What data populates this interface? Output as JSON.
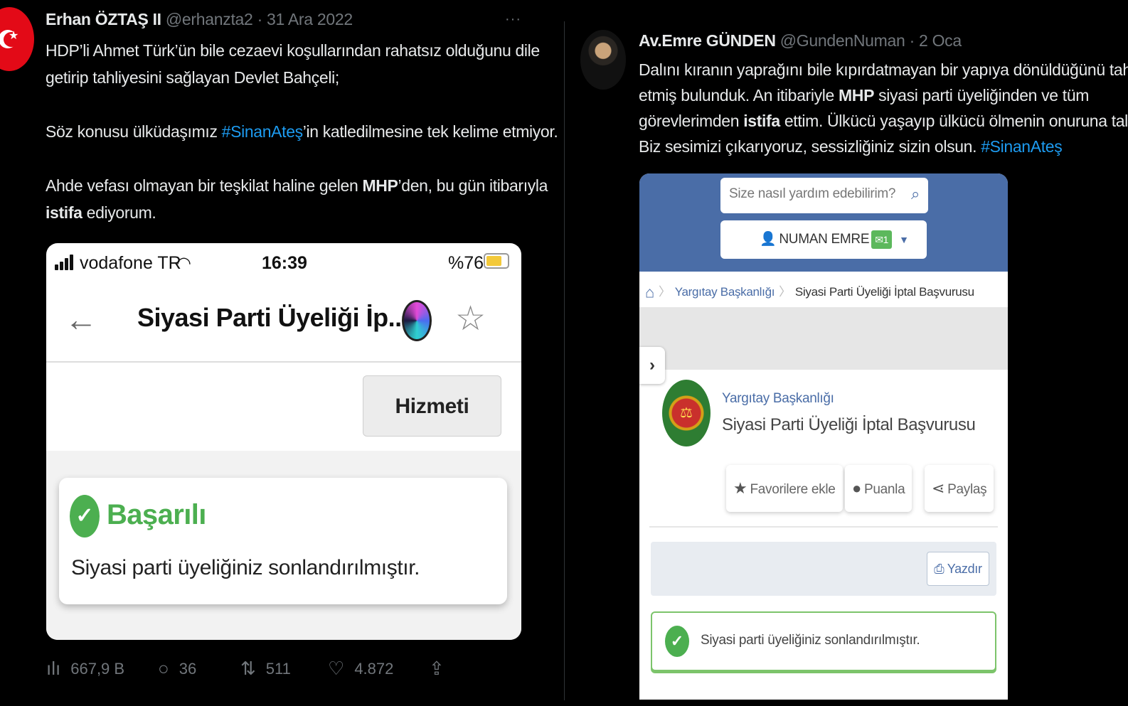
{
  "left_tweet": {
    "name": "Erhan ÖZTAŞ II",
    "handle_date": "@erhanzta2 · 31 Ara 2022",
    "more": "···",
    "p1a": "HDP’li Ahmet Türk’ün bile cezaevi koşullarından rahatsız olduğunu dile",
    "p1b": "getirip tahliyesini sağlayan Devlet Bahçeli;",
    "p2_pre": "Söz konusu ülküdaşımız ",
    "p2_tag": "#SinanAteş",
    "p2_post": "’in katledilmesine tek kelime etmiyor.",
    "p3_pre": "Ahde vefası olmayan bir teşkilat haline gelen ",
    "p3_bold": "MHP",
    "p3_post": "’den, bu gün itibarıyla",
    "p4_bold": "istifa",
    "p4_post": " ediyorum.",
    "screenshot": {
      "carrier": "vodafone TR",
      "time": "16:39",
      "battery": "%76",
      "battery_level": 0.76,
      "title": "Siyasi Parti Üyeliği İp...",
      "close_button": "Hizmeti Kapat",
      "status": "Başarılı",
      "message": "Siyasi parti üyeliğiniz sonlandırılmıştır."
    },
    "stats": {
      "views": "667,9 B",
      "replies": "36",
      "retweets": "511",
      "likes": "4.872"
    }
  },
  "right_tweet": {
    "name": "Av.Emre GÜNDEN",
    "handle_date": "@GundenNuman · 2 Oca",
    "l1": "Dalını kıranın yaprağını bile kıpırdatmayan bir yapıya dönüldüğünü tahlil",
    "l2_pre": "etmiş bulunduk. An itibariyle ",
    "l2_bold": "MHP",
    "l2_post": " siyasi parti üyeliğinden ve tüm",
    "l3_pre": "görevlerimden ",
    "l3_bold": "istifa",
    "l3_post": " ettim. Ülkücü yaşayıp ülkücü ölmenin onuruna talibiz.",
    "l4_pre": "Biz sesimizi çıkarıyoruz, sessizliğiniz sizin olsun. ",
    "l4_tag": "#SinanAteş",
    "screenshot": {
      "search_placeholder": "Size nasıl yardım edebilirim?",
      "user": "NUMAN EMRE",
      "badge": "✉1",
      "bc1": "Yargıtay Başkanlığı",
      "bc2": "Siyasi Parti Üyeliği İptal Başvurusu",
      "org": "Yargıtay Başkanlığı",
      "service": "Siyasi Parti Üyeliği İptal Başvurusu",
      "fav": "Favorilere ekle",
      "rate": "Puanla",
      "share": "Paylaş",
      "print": "Yazdır",
      "message": "Siyasi parti üyeliğiniz sonlandırılmıştır."
    }
  },
  "colors": {
    "link": "#1d9bf0",
    "success": "#4caf50",
    "gov_blue": "#4a6da7"
  }
}
